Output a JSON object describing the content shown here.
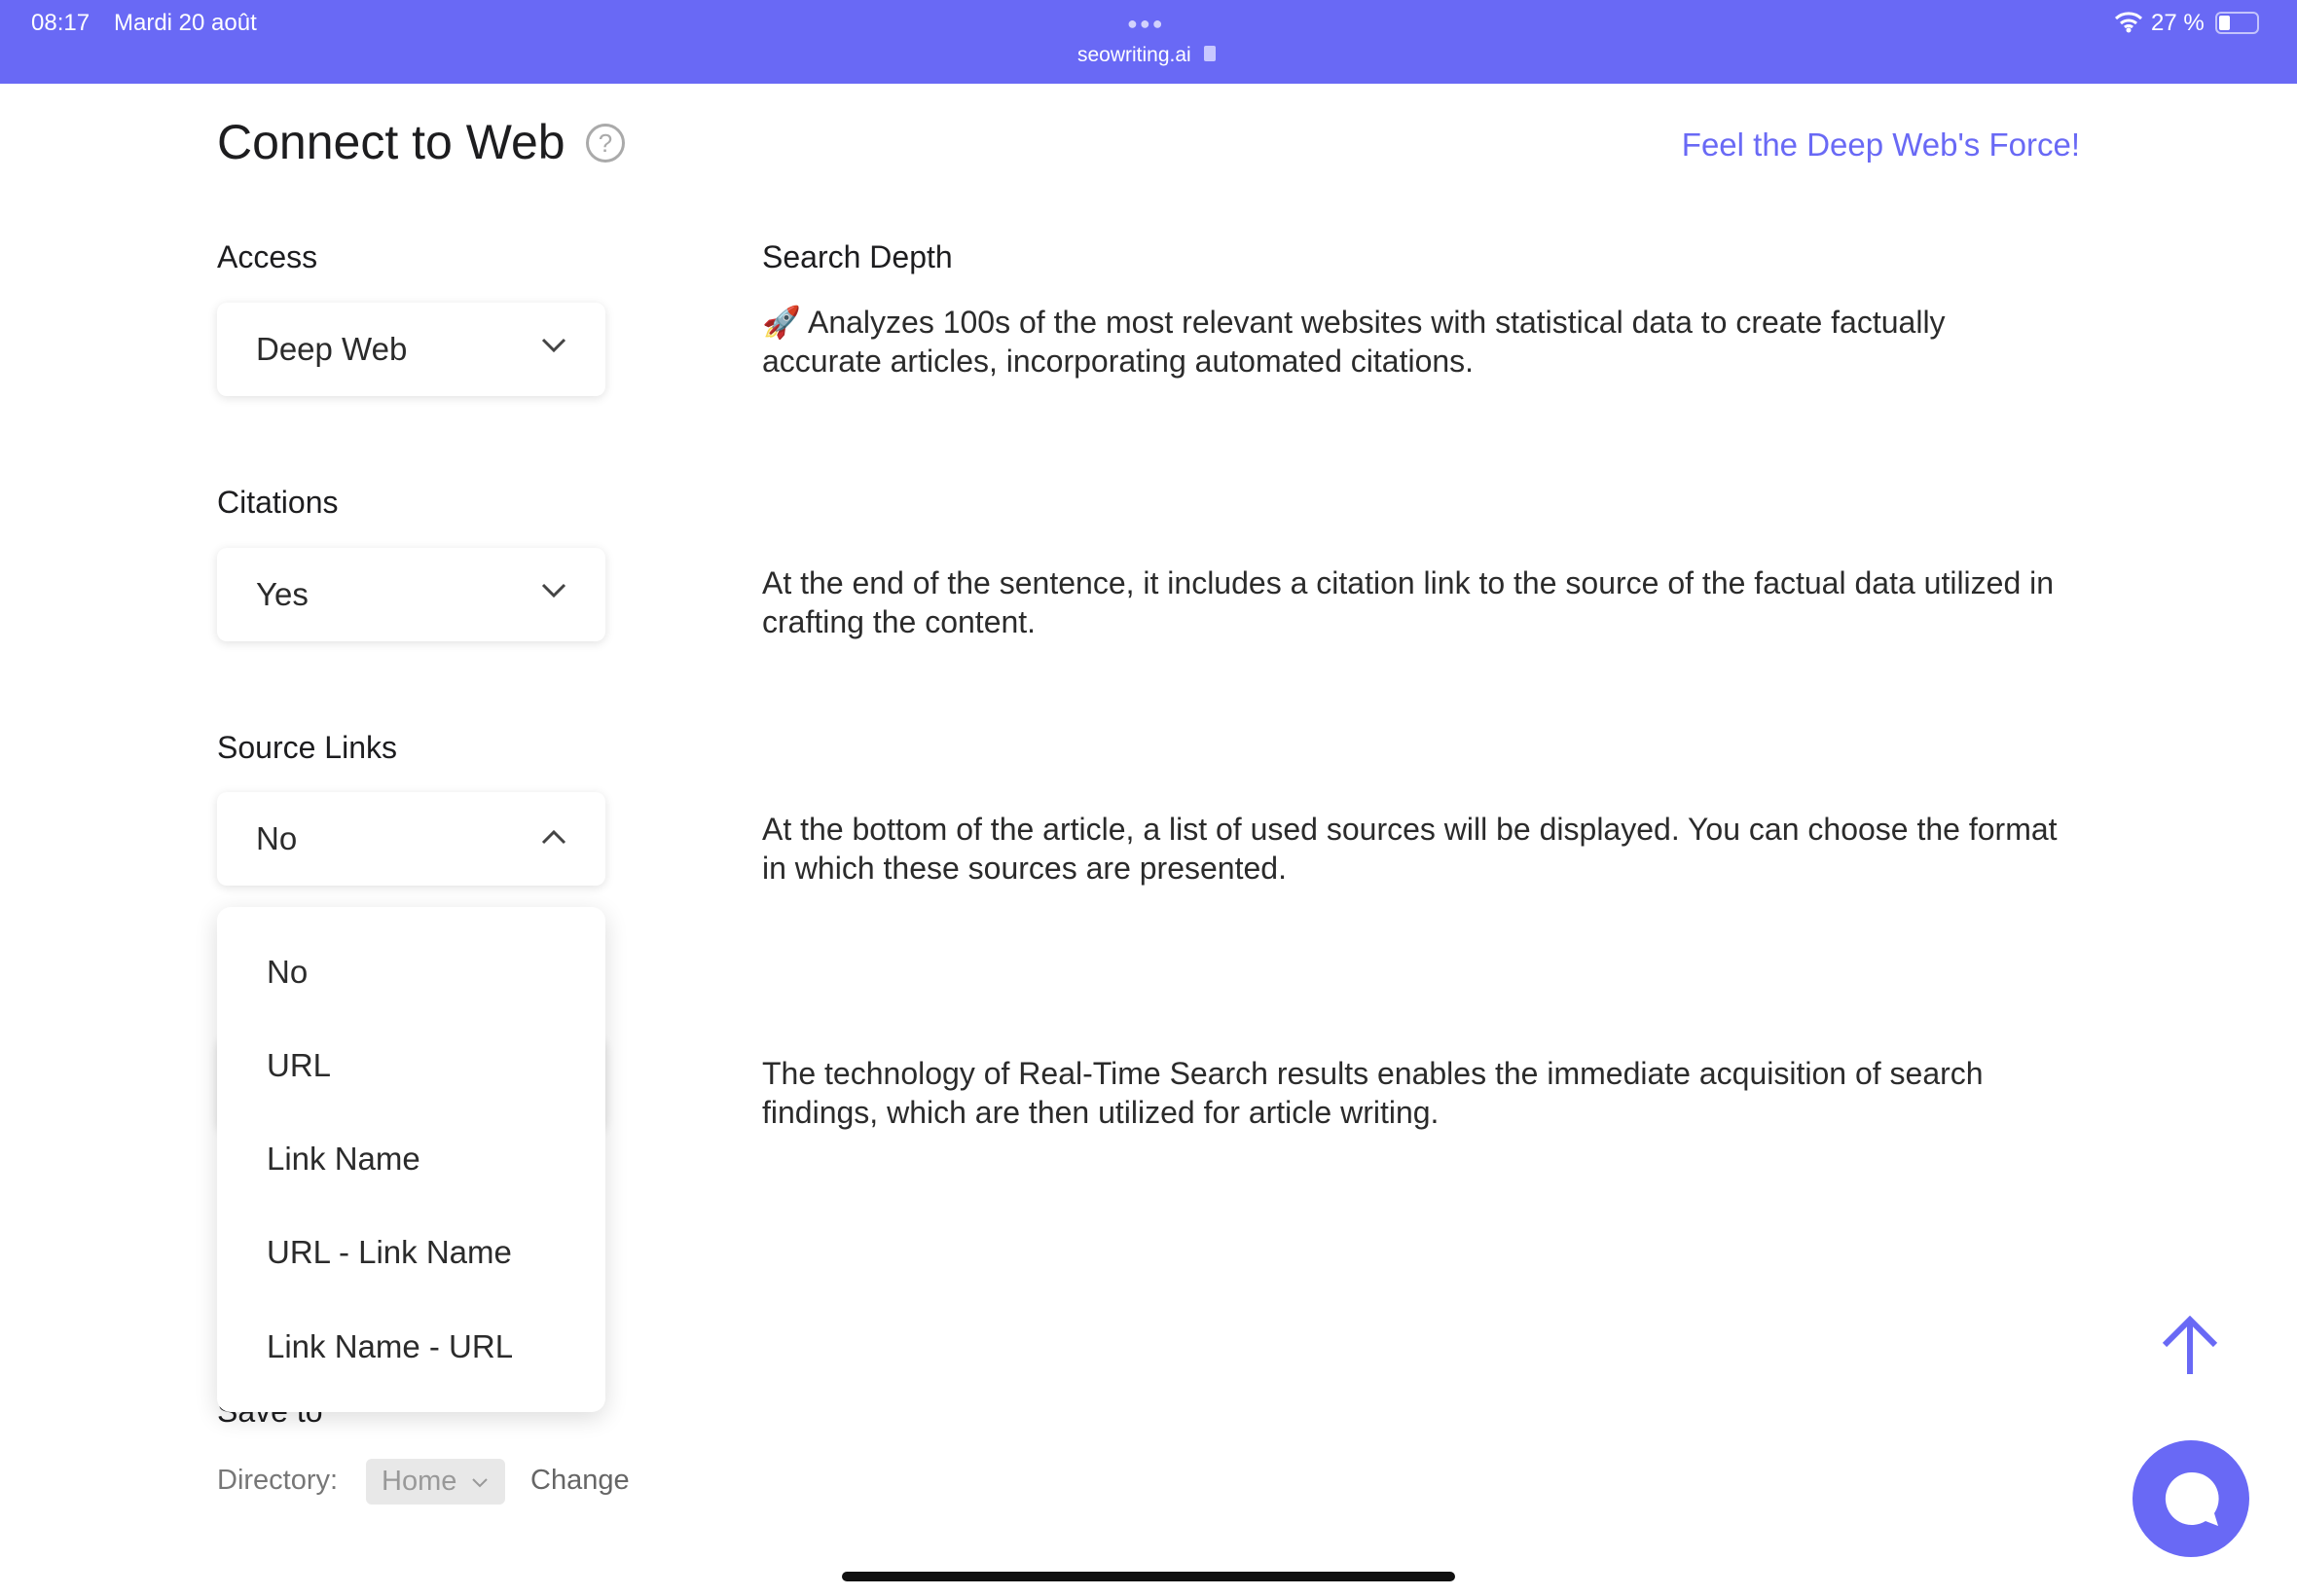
{
  "status_bar": {
    "time": "08:17",
    "date": "Mardi 20 août",
    "url": "seowriting.ai",
    "battery": "27 %",
    "battery_level": 0.27
  },
  "header": {
    "title": "Connect to Web",
    "promo_link": "Feel the Deep Web's Force!"
  },
  "fields": {
    "access": {
      "label": "Access",
      "value": "Deep Web"
    },
    "search_depth": {
      "label": "Search Depth",
      "description": "🚀 Analyzes 100s of the most relevant websites with statistical data to create factually accurate articles, incorporating automated citations."
    },
    "citations": {
      "label": "Citations",
      "value": "Yes",
      "description": "At the end of the sentence, it includes a citation link to the source of the factual data utilized in crafting the content."
    },
    "source_links": {
      "label": "Source Links",
      "value": "No",
      "description": "At the bottom of the article, a list of used sources will be displayed. You can choose the format in which these sources are presented.",
      "options": [
        "No",
        "URL",
        "Link Name",
        "URL - Link Name",
        "Link Name - URL"
      ]
    },
    "realtime": {
      "description": "The technology of Real-Time Search results enables the immediate acquisition of search findings, which are then utilized for article writing."
    }
  },
  "save_to": {
    "label": "Save to",
    "directory_label": "Directory:",
    "directory_value": "Home",
    "change_label": "Change"
  },
  "colors": {
    "accent": "#6969f5"
  }
}
